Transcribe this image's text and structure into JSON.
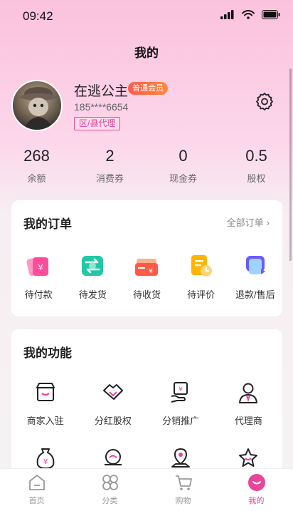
{
  "status_bar": {
    "time": "09:42"
  },
  "header": {
    "title": "我的"
  },
  "profile": {
    "name": "在逃公主",
    "member_badge": "普通会员",
    "phone": "185****6654",
    "agent_tag": "区/县代理"
  },
  "stats": [
    {
      "value": "268",
      "label": "余额"
    },
    {
      "value": "2",
      "label": "消费券"
    },
    {
      "value": "0",
      "label": "现金券"
    },
    {
      "value": "0.5",
      "label": "股权"
    }
  ],
  "orders": {
    "title": "我的订单",
    "all_link": "全部订单",
    "items": [
      {
        "label": "待付款",
        "icon": "wallet-icon"
      },
      {
        "label": "待发货",
        "icon": "exchange-icon"
      },
      {
        "label": "待收货",
        "icon": "card-receive-icon"
      },
      {
        "label": "待评价",
        "icon": "review-icon"
      },
      {
        "label": "退款/售后",
        "icon": "refund-icon"
      }
    ]
  },
  "features": {
    "title": "我的功能",
    "items": [
      {
        "label": "商家入驻",
        "icon": "store-icon"
      },
      {
        "label": "分红股权",
        "icon": "handshake-icon"
      },
      {
        "label": "分销推广",
        "icon": "promotion-icon"
      },
      {
        "label": "代理商",
        "icon": "agent-icon"
      },
      {
        "label": "",
        "icon": "money-bag-icon"
      },
      {
        "label": "",
        "icon": "coin-hand-icon"
      },
      {
        "label": "",
        "icon": "location-icon"
      },
      {
        "label": "",
        "icon": "star-icon"
      }
    ]
  },
  "tabbar": [
    {
      "label": "首页",
      "icon": "home-icon"
    },
    {
      "label": "分类",
      "icon": "category-icon"
    },
    {
      "label": "购物",
      "icon": "cart-icon"
    },
    {
      "label": "我的",
      "icon": "profile-icon",
      "active": true
    }
  ],
  "colors": {
    "accent": "#e8459a",
    "badge": "#ff6a45"
  }
}
